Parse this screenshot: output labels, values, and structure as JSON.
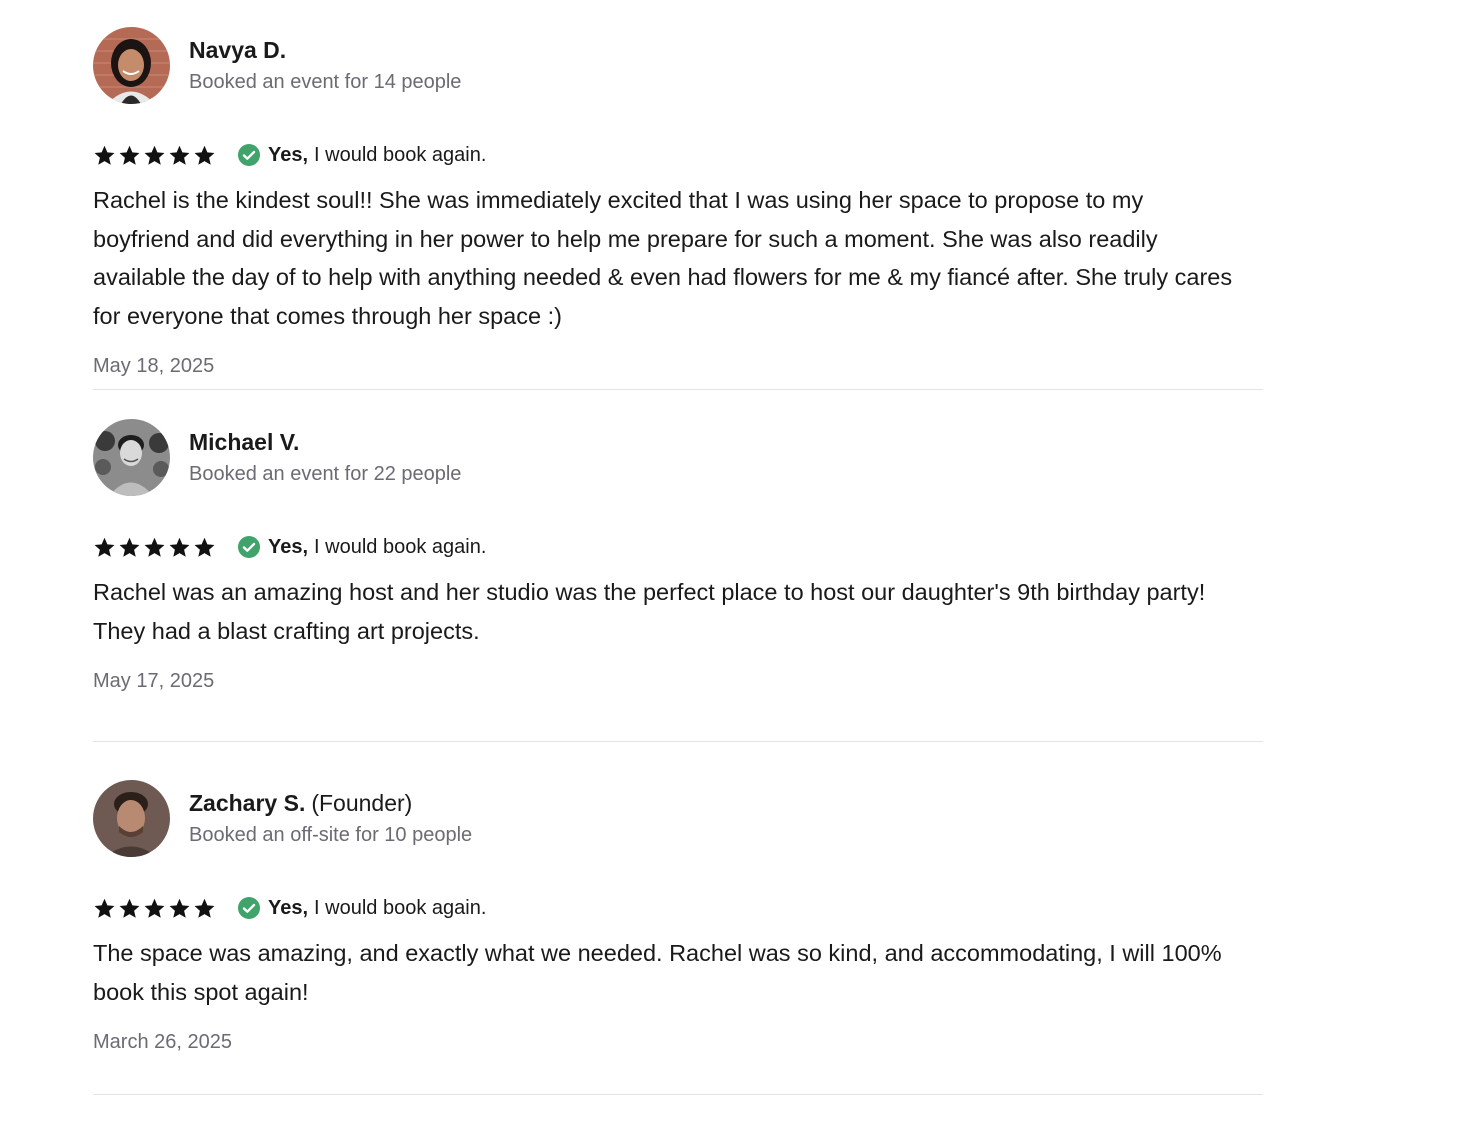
{
  "reviews": [
    {
      "name": "Navya D.",
      "badge": "",
      "booking": "Booked an event for 14 people",
      "rating": 5,
      "recommend_yes": "Yes,",
      "recommend_text": "I would book again.",
      "text": "Rachel is the kindest soul!! She was immediately excited that I was using her space to propose to my boyfriend and did everything in her power to help me prepare for such a moment. She was also readily available the day of to help with anything needed & even had flowers for me & my fiancé after. She truly cares for everyone that comes through her space :)",
      "date": "May 18, 2025"
    },
    {
      "name": "Michael V.",
      "badge": "",
      "booking": "Booked an event for 22 people",
      "rating": 5,
      "recommend_yes": "Yes,",
      "recommend_text": "I would book again.",
      "text": "Rachel was an amazing host and her studio was the perfect place to host our daughter's 9th birthday party! They had a blast crafting art projects.",
      "date": "May 17, 2025"
    },
    {
      "name": "Zachary S.",
      "badge": "(Founder)",
      "booking": "Booked an off-site for 10 people",
      "rating": 5,
      "recommend_yes": "Yes,",
      "recommend_text": "I would book again.",
      "text": "The space was amazing, and exactly what we needed. Rachel was so kind, and accommodating, I will 100% book this spot again!",
      "date": "March 26, 2025"
    }
  ],
  "colors": {
    "star": "#111111",
    "check": "#3fa36b",
    "muted_text": "#6b6b73",
    "divider": "#e4e4e4"
  },
  "icons": {
    "star": "star-icon",
    "check": "check-circle-icon"
  }
}
